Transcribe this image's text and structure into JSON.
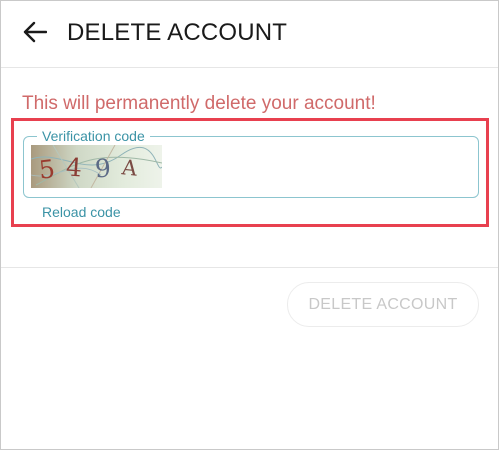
{
  "header": {
    "title": "DELETE ACCOUNT",
    "back_icon": "arrow-left-icon"
  },
  "warning": {
    "text": "This will permanently delete your account!",
    "color": "#d06a6a"
  },
  "verification": {
    "label": "Verification code",
    "captcha_text": "549A",
    "reload_label": "Reload code"
  },
  "actions": {
    "delete_label": "DELETE ACCOUNT"
  },
  "colors": {
    "accent": "#3b93a6",
    "highlight": "#e8404f",
    "disabled_text": "#c8c8c8"
  }
}
